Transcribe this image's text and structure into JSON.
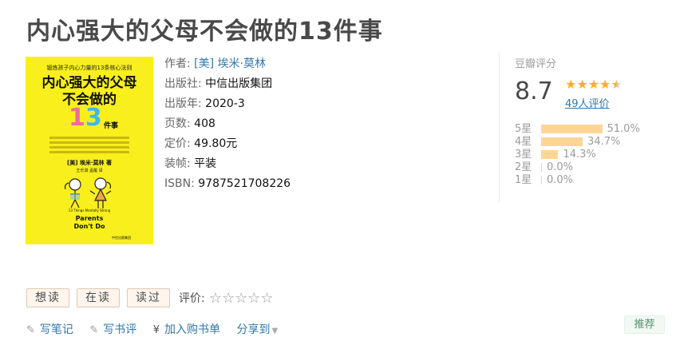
{
  "book": {
    "title": "内心强大的父母不会做的13件事"
  },
  "cover": {
    "top_line": "锻炼孩子内心力量的13条核心法则",
    "main_line1": "内心强大的父母",
    "main_line2": "不会做的",
    "digit1": "1",
    "digit3": "3",
    "jian": "件事",
    "author": "[美] 埃米·莫林 著",
    "translators": "王乐淇  孟醒  译",
    "subtitle_en": "13 Things Mentally Strong",
    "en_line1": "Parents",
    "en_line2": "Don't Do",
    "publisher": "中信出版集团"
  },
  "info": {
    "author_label": "作者:",
    "author_value": "[美] 埃米·莫林",
    "publisher_label": "出版社:",
    "publisher_value": "中信出版集团",
    "year_label": "出版年:",
    "year_value": "2020-3",
    "pages_label": "页数:",
    "pages_value": "408",
    "price_label": "定价:",
    "price_value": "49.80元",
    "binding_label": "装帧:",
    "binding_value": "平装",
    "isbn_label": "ISBN:",
    "isbn_value": "9787521708226"
  },
  "rating": {
    "title": "豆瓣评分",
    "score": "8.7",
    "stars_full": "★★★★",
    "stars_half": "★",
    "stars_value": 4.5,
    "votes": "49人评价",
    "distribution": [
      {
        "label": "5星",
        "percent": "51.0%",
        "value": 51.0
      },
      {
        "label": "4星",
        "percent": "34.7%",
        "value": 34.7
      },
      {
        "label": "3星",
        "percent": "14.3%",
        "value": 14.3
      },
      {
        "label": "2星",
        "percent": "0.0%",
        "value": 0.0
      },
      {
        "label": "1星",
        "percent": "0.0%",
        "value": 0.0
      }
    ],
    "bar_color": "#ffd596"
  },
  "actions": {
    "want": "想读",
    "reading": "在读",
    "read": "读过",
    "rate_label": "评价:",
    "rate_stars": "☆☆☆☆☆"
  },
  "links": {
    "note_icon": "pencil-icon",
    "note": "写笔记",
    "review_icon": "pencil-icon",
    "review": "写书评",
    "cart_icon": "yen-icon",
    "cart": "加入购书单",
    "share": "分享到"
  },
  "recommend": "推荐",
  "colors": {
    "link": "#3377aa",
    "star": "#ffac2d",
    "cover": "#f8ef1c"
  }
}
